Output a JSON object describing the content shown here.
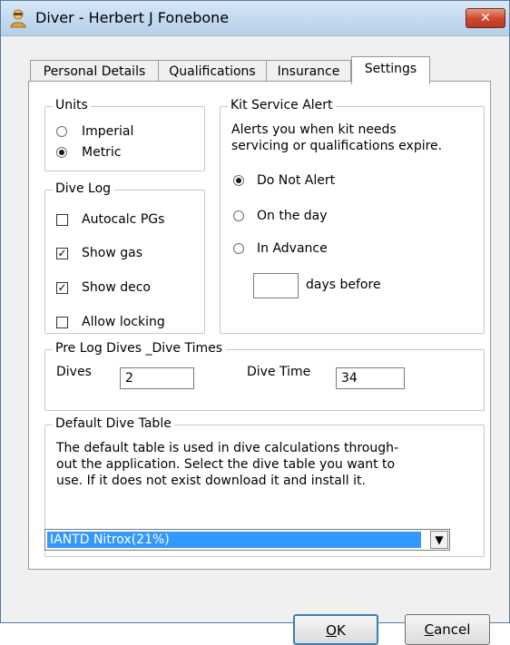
{
  "window": {
    "title": "Diver - Herbert J Fonebone",
    "close_glyph": "✕"
  },
  "tabs": [
    {
      "label": "Personal Details",
      "active": false
    },
    {
      "label": "Qualifications",
      "active": false
    },
    {
      "label": "Insurance",
      "active": false
    },
    {
      "label": "Settings",
      "active": true
    }
  ],
  "units": {
    "legend": "Units",
    "options": [
      {
        "label": "Imperial",
        "selected": false
      },
      {
        "label": "Metric",
        "selected": true
      }
    ]
  },
  "dive_log": {
    "legend": "Dive Log",
    "options": [
      {
        "label": "Autocalc PGs",
        "checked": false
      },
      {
        "label": "Show gas",
        "checked": true
      },
      {
        "label": "Show deco",
        "checked": true
      },
      {
        "label": "Allow locking",
        "checked": false
      }
    ]
  },
  "kit_alert": {
    "legend": "Kit Service Alert",
    "description_line1": "Alerts you when kit needs",
    "description_line2": "servicing or qualifications expire.",
    "options": [
      {
        "label": "Do Not Alert",
        "selected": true
      },
      {
        "label": "On the day",
        "selected": false
      },
      {
        "label": "In Advance",
        "selected": false
      }
    ],
    "days_value": "",
    "days_label": "days before"
  },
  "pre_log": {
    "legend": "Pre Log Dives _Dive Times",
    "dives_label": "Dives",
    "dives_value": "2",
    "time_label": "Dive Time",
    "time_value": "34"
  },
  "dive_table": {
    "legend": "Default Dive Table",
    "desc_line1": "The default table is used in dive calculations through-",
    "desc_line2": "out the application. Select the dive table you want to",
    "desc_line3": "use. If it does not exist download it and install it.",
    "selected": "IANTD Nitrox(21%)",
    "arrow_glyph": "▼"
  },
  "buttons": {
    "ok_mnemonic": "O",
    "ok_rest": "K",
    "cancel_mnemonic": "C",
    "cancel_rest": "ancel"
  }
}
